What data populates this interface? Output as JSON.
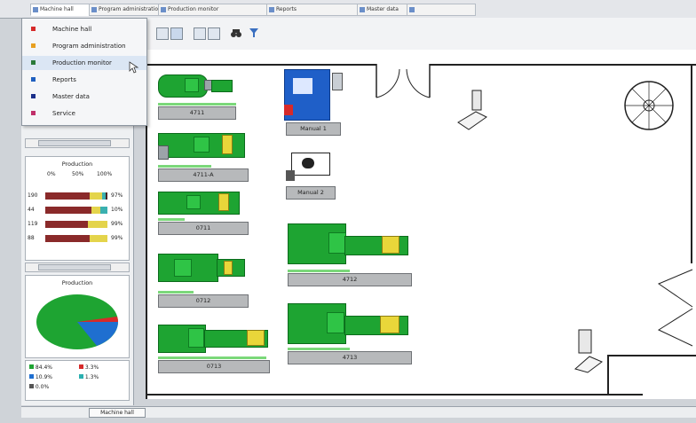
{
  "tabs": [
    {
      "label": "Machine hall"
    },
    {
      "label": "Program administration"
    },
    {
      "label": "Production monitor"
    },
    {
      "label": "Reports"
    },
    {
      "label": "Master data"
    }
  ],
  "menu": {
    "items": [
      {
        "label": "Machine hall",
        "color": "#d62a2a"
      },
      {
        "label": "Program administration",
        "color": "#e8a020"
      },
      {
        "label": "Production monitor",
        "color": "#2a7a3a"
      },
      {
        "label": "Reports",
        "color": "#1f5fbf"
      },
      {
        "label": "Master data",
        "color": "#1a2f8a"
      },
      {
        "label": "Service",
        "color": "#c0306a"
      }
    ]
  },
  "production_panel": {
    "title": "Production",
    "scale": [
      "0%",
      "50%",
      "100%"
    ],
    "rows": [
      {
        "label": "190",
        "value": "97%",
        "fill": 0.97
      },
      {
        "label": "44",
        "value": "10%",
        "fill": 0.1
      },
      {
        "label": "119",
        "value": "99%",
        "fill": 0.99
      },
      {
        "label": "88",
        "value": "99%",
        "fill": 0.99
      }
    ]
  },
  "pie_panel": {
    "title": "Production",
    "legend": [
      {
        "label": "84.4%",
        "color": "#1ea432"
      },
      {
        "label": "3.3%",
        "color": "#d62a2a"
      },
      {
        "label": "10.9%",
        "color": "#1f6fd0"
      },
      {
        "label": "1.3%",
        "color": "#2ab0b0"
      },
      {
        "label": "0.0%",
        "color": "#555555"
      }
    ]
  },
  "machines": [
    {
      "label": "4711"
    },
    {
      "label": "4711-A"
    },
    {
      "label": "0711"
    },
    {
      "label": "0712"
    },
    {
      "label": "0713"
    },
    {
      "label": "4712"
    },
    {
      "label": "4713"
    },
    {
      "label": "Manual 1"
    },
    {
      "label": "Manual 2"
    }
  ],
  "status": {
    "tab_label": "Machine hall"
  }
}
